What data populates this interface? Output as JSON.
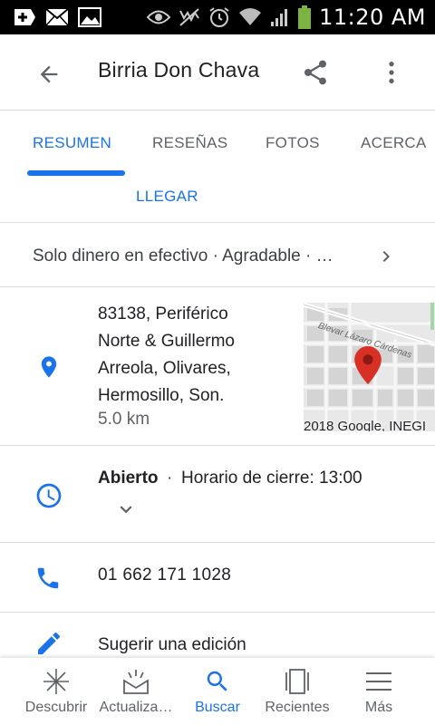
{
  "status_bar": {
    "time": "11:20 AM",
    "left_icons": [
      "add-notification-icon",
      "mail-icon",
      "image-icon"
    ],
    "right_icons": [
      "eye-icon",
      "mute-icon",
      "alarm-icon",
      "wifi-icon",
      "signal-icon",
      "battery-icon"
    ]
  },
  "app_bar": {
    "title": "Birria Don Chava",
    "back_icon": "arrow-back-icon",
    "share_icon": "share-icon",
    "more_icon": "more-vert-icon"
  },
  "tabs": [
    {
      "label": "RESUMEN",
      "active": true
    },
    {
      "label": "RESEÑAS",
      "active": false
    },
    {
      "label": "FOTOS",
      "active": false
    },
    {
      "label": "ACERCA",
      "active": false
    }
  ],
  "llegar_label": "LLEGAR",
  "attributes": {
    "text": "Solo dinero en efectivo · Agradable · …",
    "icon": "chevron-right-icon"
  },
  "address": {
    "lines": [
      "83138, Periférico",
      "Norte & Guillermo",
      "Arreola, Olivares,",
      "Hermosillo, Son."
    ],
    "distance": "5.0 km",
    "map_credit": "2018 Google, INEGI",
    "map_street": "Blevar Lázaro Cárdenas",
    "icon": "location-pin-icon"
  },
  "hours": {
    "status": "Abierto",
    "separator": "·",
    "closing": "Horario de cierre: 13:00",
    "icon": "clock-icon"
  },
  "phone": {
    "number": "01 662 171 1028",
    "icon": "phone-icon"
  },
  "suggest": {
    "label": "Sugerir una edición",
    "icon": "pencil-icon"
  },
  "bottom_nav": [
    {
      "label": "Descubrir",
      "icon": "explore-icon",
      "active": false
    },
    {
      "label": "Actualiza…",
      "icon": "updates-icon",
      "active": false
    },
    {
      "label": "Buscar",
      "icon": "search-icon",
      "active": true
    },
    {
      "label": "Recientes",
      "icon": "recents-icon",
      "active": false
    },
    {
      "label": "Más",
      "icon": "menu-icon",
      "active": false
    }
  ],
  "colors": {
    "accent": "#1a73e8",
    "map_pin": "#d93025"
  }
}
